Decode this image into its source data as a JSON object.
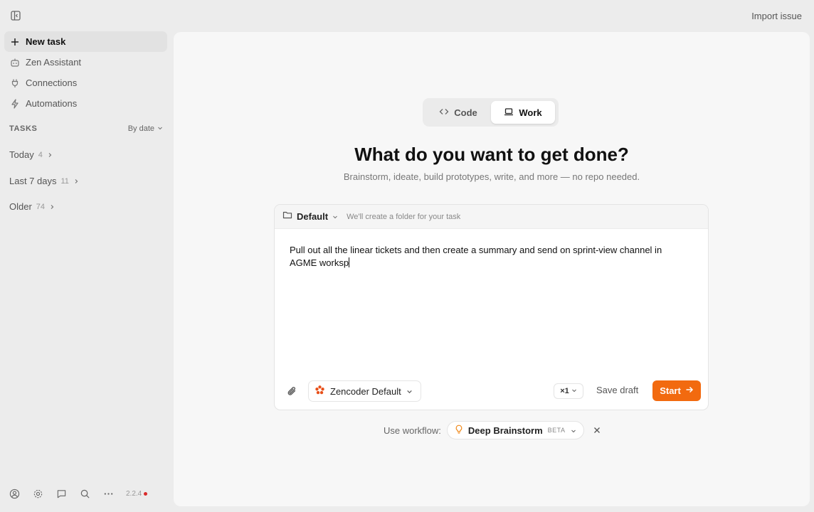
{
  "header": {
    "import_label": "Import issue"
  },
  "sidebar": {
    "items": [
      {
        "label": "New task",
        "icon": "plus-icon"
      },
      {
        "label": "Zen Assistant",
        "icon": "robot-icon"
      },
      {
        "label": "Connections",
        "icon": "plug-icon"
      },
      {
        "label": "Automations",
        "icon": "bolt-icon"
      }
    ],
    "tasks_heading": "TASKS",
    "sort_label": "By date",
    "groups": [
      {
        "label": "Today",
        "count": "4"
      },
      {
        "label": "Last 7 days",
        "count": "11"
      },
      {
        "label": "Older",
        "count": "74"
      }
    ],
    "version": "2.2.4"
  },
  "main": {
    "mode_tabs": [
      {
        "label": "Code",
        "selected": false
      },
      {
        "label": "Work",
        "selected": true
      }
    ],
    "title": "What do you want to get done?",
    "subtitle": "Brainstorm, ideate, build prototypes, write, and more — no repo needed.",
    "folder": {
      "name": "Default",
      "hint": "We'll create a folder for your task"
    },
    "prompt_text": "Pull out all the linear tickets and then create a summary and send on sprint-view channel in AGME worksp",
    "agent_label": "Zencoder Default",
    "multiplier": "×1",
    "save_draft_label": "Save draft",
    "start_label": "Start",
    "workflow": {
      "prefix": "Use workflow:",
      "name": "Deep Brainstorm",
      "badge": "BETA"
    }
  },
  "colors": {
    "accent": "#f26a0f",
    "status_dot": "#d92b2b"
  }
}
